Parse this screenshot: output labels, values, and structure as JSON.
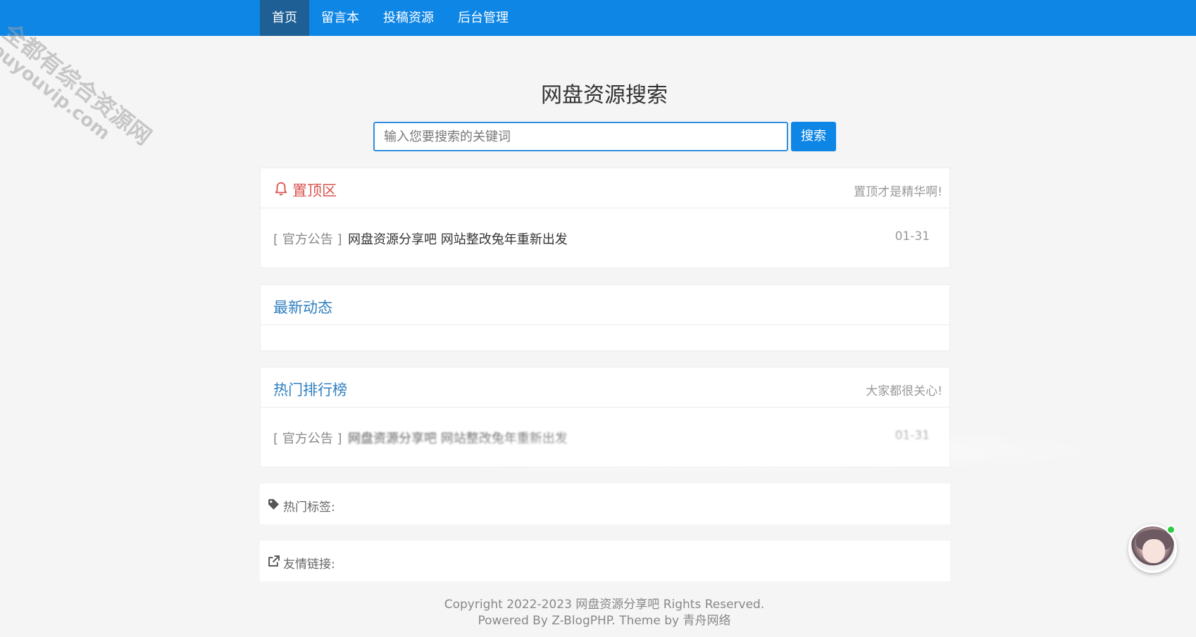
{
  "nav": {
    "items": [
      {
        "label": "首页",
        "active": true
      },
      {
        "label": "留言本",
        "active": false
      },
      {
        "label": "投稿资源",
        "active": false
      },
      {
        "label": "后台管理",
        "active": false
      }
    ]
  },
  "watermark": {
    "line1": "全都有综合资源网",
    "line2": "douyouvip.com"
  },
  "search": {
    "title": "网盘资源搜索",
    "placeholder": "输入您要搜索的关键词",
    "button": "搜索"
  },
  "pinned": {
    "title": "置顶区",
    "note": "置顶才是精华啊!",
    "icon": "bell-icon",
    "items": [
      {
        "tag": "[ 官方公告 ]",
        "title": "网盘资源分享吧 网站整改兔年重新出发",
        "date": "01-31"
      }
    ]
  },
  "latest": {
    "title": "最新动态"
  },
  "hot": {
    "title": "热门排行榜",
    "note": "大家都很关心!",
    "items": [
      {
        "tag": "[ 官方公告 ]",
        "title": "网盘资源分享吧 网站整改兔年重新出发",
        "date": "01-31"
      }
    ]
  },
  "tags": {
    "label": "热门标签:",
    "icon": "tag-icon"
  },
  "links": {
    "label": "友情链接:",
    "icon": "external-link-icon"
  },
  "footer": {
    "line1": "Copyright 2022-2023 网盘资源分享吧 Rights Reserved.",
    "line2": "Powered By Z-BlogPHP. Theme by 青舟网络"
  },
  "colors": {
    "nav_bg": "#0e86e6",
    "nav_active": "#1e5f95",
    "accent": "#2f7fc1",
    "pinned_red": "#d9534f",
    "online": "#2ecc40"
  }
}
